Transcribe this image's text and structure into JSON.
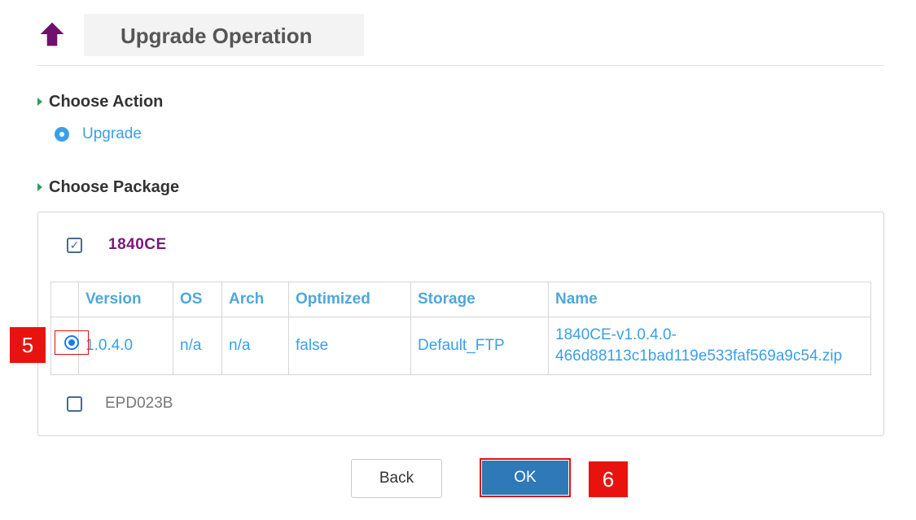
{
  "header": {
    "title": "Upgrade Operation",
    "icon": "arrow-up-icon",
    "icon_color": "#6e116e"
  },
  "sections": {
    "action_title": "Choose Action",
    "package_title": "Choose Package"
  },
  "action": {
    "option_label": "Upgrade",
    "selected": true
  },
  "packages": [
    {
      "name": "1840CE",
      "checked": true
    },
    {
      "name": "EPD023B",
      "checked": false
    }
  ],
  "table": {
    "columns": [
      "",
      "Version",
      "OS",
      "Arch",
      "Optimized",
      "Storage",
      "Name"
    ],
    "rows": [
      {
        "selected": true,
        "version": "1.0.4.0",
        "os": "n/a",
        "arch": "n/a",
        "optimized": "false",
        "storage": "Default_FTP",
        "name_line1": "1840CE-v1.0.4.0-",
        "name_line2": "466d88113c1bad119e533faf569a9c54.zip"
      }
    ]
  },
  "buttons": {
    "back": "Back",
    "ok": "OK"
  },
  "steps": {
    "step_radio": "5",
    "step_ok": "6"
  },
  "colors": {
    "accent_blue": "#3aa0ea",
    "ok_button": "#2f79b9",
    "highlight_red": "#e01010",
    "package_purple": "#7a1a7a"
  }
}
